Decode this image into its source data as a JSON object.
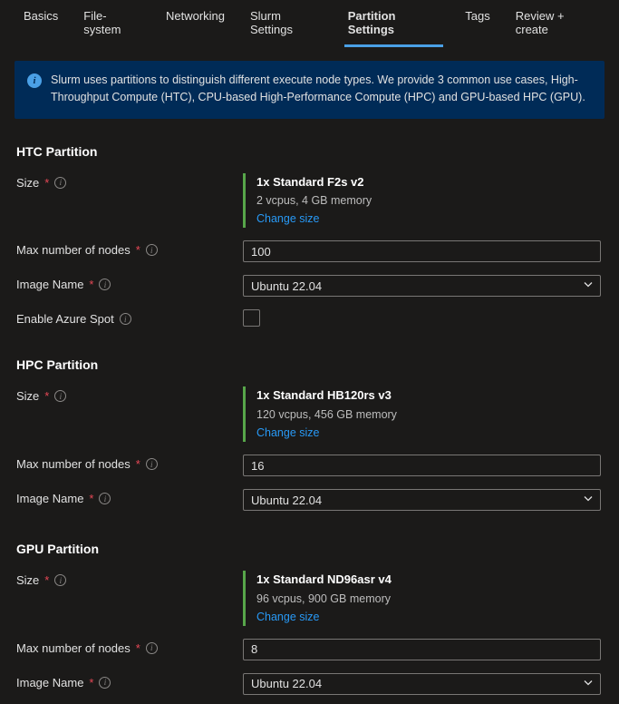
{
  "tabs": [
    {
      "label": "Basics"
    },
    {
      "label": "File-system"
    },
    {
      "label": "Networking"
    },
    {
      "label": "Slurm Settings"
    },
    {
      "label": "Partition Settings"
    },
    {
      "label": "Tags"
    },
    {
      "label": "Review + create"
    }
  ],
  "activeTabIndex": 4,
  "banner": "Slurm uses partitions to distinguish different execute node types. We provide 3 common use cases, High-Throughput Compute (HTC), CPU-based High-Performance Compute (HPC) and GPU-based HPC (GPU).",
  "labels": {
    "size": "Size",
    "maxNodes": "Max number of nodes",
    "imageName": "Image Name",
    "enableSpot": "Enable Azure Spot",
    "changeSize": "Change size"
  },
  "htc": {
    "title": "HTC Partition",
    "sizeName": "1x Standard F2s v2",
    "sizeDetail": "2 vcpus, 4 GB memory",
    "maxNodes": "100",
    "image": "Ubuntu 22.04",
    "spot": false
  },
  "hpc": {
    "title": "HPC Partition",
    "sizeName": "1x Standard HB120rs v3",
    "sizeDetail": "120 vcpus, 456 GB memory",
    "maxNodes": "16",
    "image": "Ubuntu 22.04"
  },
  "gpu": {
    "title": "GPU Partition",
    "sizeName": "1x Standard ND96asr v4",
    "sizeDetail": "96 vcpus, 900 GB memory",
    "maxNodes": "8",
    "image": "Ubuntu 22.04"
  }
}
